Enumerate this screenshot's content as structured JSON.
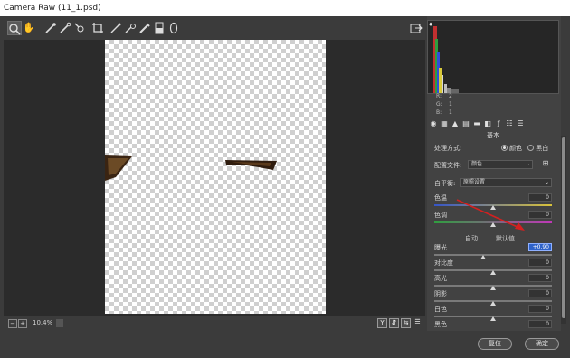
{
  "window": {
    "title": "Camera Raw (11_1.psd)"
  },
  "toolbar": {
    "tools": [
      "zoom-icon",
      "hand-icon",
      "white-balance-icon",
      "color-sampler-icon",
      "target-adjust-icon",
      "crop-icon",
      "straighten-icon",
      "spot-removal-icon",
      "red-eye-icon",
      "adjustment-brush-icon",
      "graduated-filter-icon",
      "radial-filter-icon"
    ],
    "open_prefs_icon": "open-image-icon"
  },
  "statusbar": {
    "zoom": "10.4%"
  },
  "histogram": {
    "r_label": "R:",
    "g_label": "G:",
    "b_label": "B:",
    "r_value": "2",
    "g_value": "1",
    "b_value": "1"
  },
  "panel": {
    "section_title": "基本",
    "treatment_label": "处理方式:",
    "treatment_color": "颜色",
    "treatment_bw": "黑白",
    "profile_label": "配置文件:",
    "profile_value": "颜色",
    "wb_label": "白平衡:",
    "wb_value": "原照设置",
    "temp_label": "色温",
    "temp_value": "0",
    "tint_label": "色调",
    "tint_value": "0",
    "auto_label": "自动",
    "default_label": "默认值",
    "exposure_label": "曝光",
    "exposure_value": "+0.90",
    "contrast_label": "对比度",
    "contrast_value": "0",
    "highlights_label": "高光",
    "highlights_value": "0",
    "shadows_label": "阴影",
    "shadows_value": "0",
    "whites_label": "白色",
    "whites_value": "0",
    "blacks_label": "黑色",
    "blacks_value": "0"
  },
  "buttons": {
    "reset": "复位",
    "ok": "确定"
  },
  "colors": {
    "accent": "#2e62c9",
    "annotation_arrow": "#d42020"
  }
}
